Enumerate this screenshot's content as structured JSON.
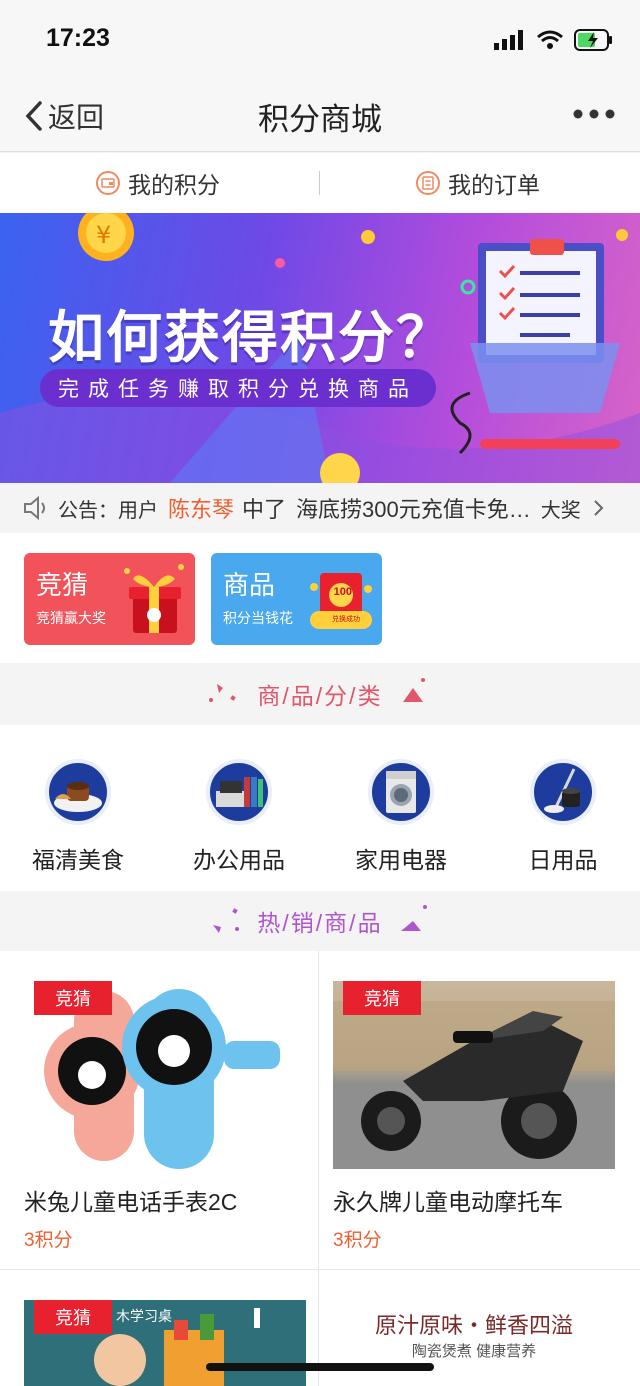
{
  "status": {
    "time": "17:23"
  },
  "nav": {
    "back_label": "返回",
    "title": "积分商城"
  },
  "tabs": [
    {
      "label": "我的积分"
    },
    {
      "label": "我的订单"
    }
  ],
  "banner": {
    "title": "如何获得积分？",
    "subtitle": "完成任务赚取积分兑换商品"
  },
  "notice": {
    "prefix": "公告：用户",
    "user": "陈东琴",
    "middle": "中了",
    "prize": "海底捞300元充值卡免…",
    "suffix": "大奖"
  },
  "entry_cards": [
    {
      "title": "竞猜",
      "subtitle": "竞猜赢大奖",
      "color": "#f2525a"
    },
    {
      "title": "商品",
      "subtitle": "积分当钱花",
      "color": "#4aa8ef",
      "badge": "100",
      "badge_text": "兑换成功"
    }
  ],
  "section_category": {
    "title": "商/品/分/类"
  },
  "categories": [
    {
      "label": "福清美食",
      "icon": "food-icon"
    },
    {
      "label": "办公用品",
      "icon": "office-icon"
    },
    {
      "label": "家用电器",
      "icon": "appliance-icon"
    },
    {
      "label": "日用品",
      "icon": "daily-icon"
    }
  ],
  "section_hot": {
    "title": "热/销/商/品"
  },
  "products": [
    {
      "tag": "竞猜",
      "name": "米兔儿童电话手表2C",
      "points": "3积分"
    },
    {
      "tag": "竞猜",
      "name": "永久牌儿童电动摩托车",
      "points": "3积分"
    },
    {
      "tag": "竞猜",
      "image_text": "木学习桌"
    },
    {
      "image_title": "原汁原味・鲜香四溢",
      "image_sub": "陶瓷煲煮 健康营养"
    }
  ],
  "colors": {
    "accent": "#f06030",
    "guess_tag": "#e8212f",
    "category_title": "#e0566a",
    "hot_title": "#b055d0"
  }
}
